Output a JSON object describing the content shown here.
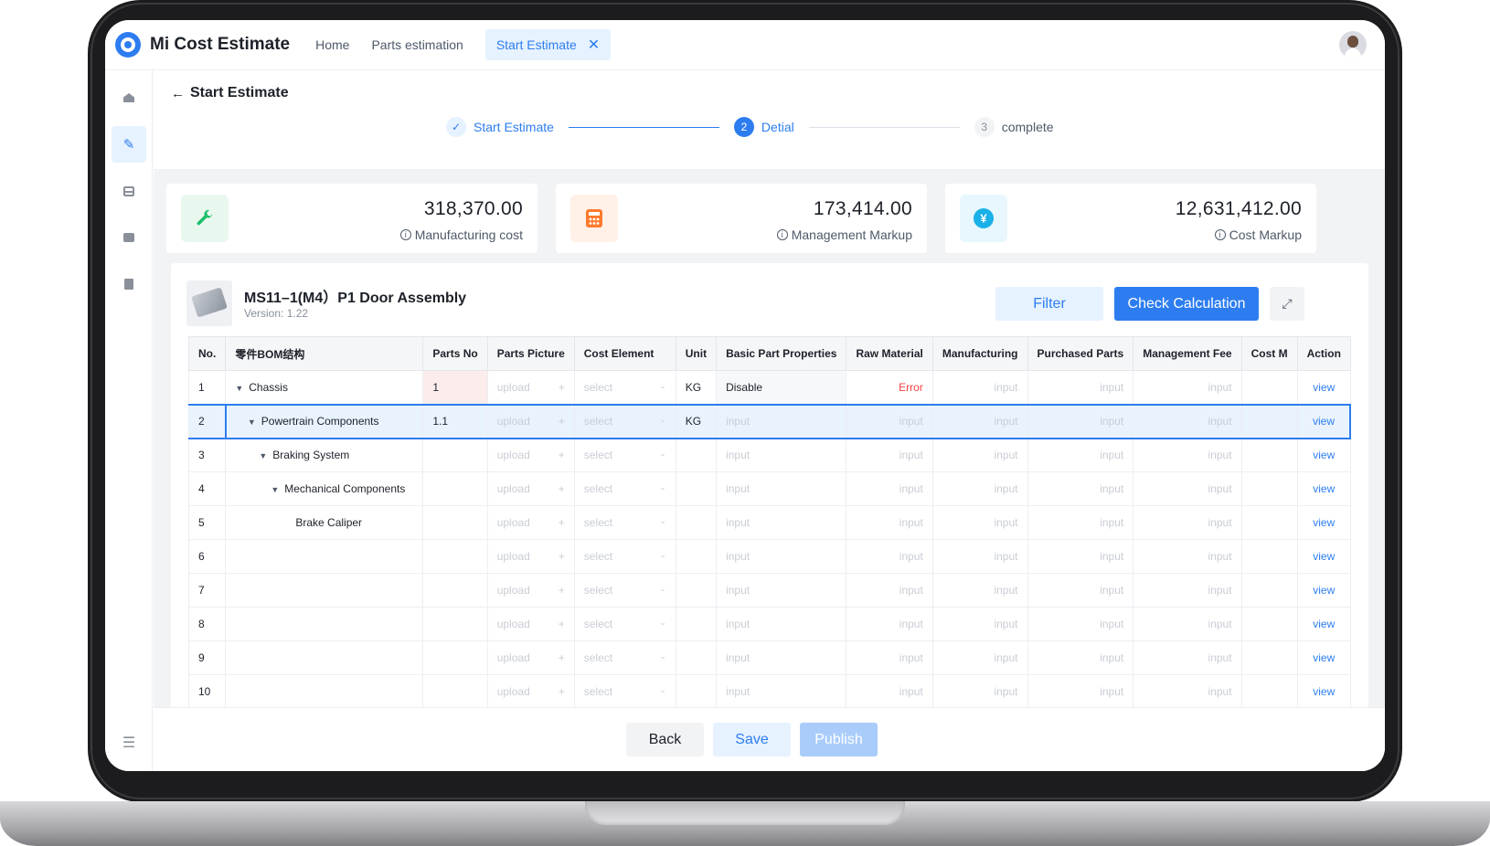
{
  "app": {
    "title": "Mi Cost Estimate"
  },
  "nav": {
    "home": "Home",
    "parts_estimation": "Parts estimation",
    "active_tab": "Start Estimate"
  },
  "page": {
    "title": "Start Estimate"
  },
  "steps": [
    {
      "num": "✓",
      "label": "Start Estimate",
      "state": "done"
    },
    {
      "num": "2",
      "label": "Detial",
      "state": "current"
    },
    {
      "num": "3",
      "label": "complete",
      "state": "todo"
    }
  ],
  "stats": [
    {
      "value": "318,370.00",
      "label": "Manufacturing cost",
      "icon": "wrench-icon",
      "color": "#1fbf6b"
    },
    {
      "value": "173,414.00",
      "label": "Management Markup",
      "icon": "calculator-icon",
      "color": "#ff7a2e"
    },
    {
      "value": "12,631,412.00",
      "label": "Cost Markup",
      "icon": "yen-icon",
      "color": "#1ab0e8"
    }
  ],
  "product": {
    "title": "MS11–1(M4）P1 Door Assembly",
    "version": "Version: 1.22"
  },
  "toolbar": {
    "filter": "Filter",
    "check": "Check Calculation"
  },
  "table": {
    "headers": [
      "No.",
      "零件BOM结构",
      "Parts No",
      "Parts Picture",
      "Cost Element",
      "Unit",
      "Basic Part Properties",
      "Raw Material",
      "Manufacturing",
      "Purchased Parts",
      "Management Fee",
      "Cost M",
      "Action"
    ],
    "placeholders": {
      "upload": "upload",
      "select": "select",
      "input": "input"
    },
    "action_label": "view",
    "rows": [
      {
        "no": "1",
        "name": "Chassis",
        "parts_no": "1",
        "unit": "KG",
        "basic": "Disable",
        "raw": "Error"
      },
      {
        "no": "2",
        "name": "Powertrain Components",
        "parts_no": "1.1",
        "unit": "KG",
        "basic": "",
        "raw": ""
      },
      {
        "no": "3",
        "name": "Braking System",
        "parts_no": "",
        "unit": "",
        "basic": "",
        "raw": ""
      },
      {
        "no": "4",
        "name": "Mechanical Components",
        "parts_no": "",
        "unit": "",
        "basic": "",
        "raw": ""
      },
      {
        "no": "5",
        "name": "Brake Caliper",
        "parts_no": "",
        "unit": "",
        "basic": "",
        "raw": ""
      },
      {
        "no": "6",
        "name": "",
        "parts_no": "",
        "unit": "",
        "basic": "",
        "raw": ""
      },
      {
        "no": "7",
        "name": "",
        "parts_no": "",
        "unit": "",
        "basic": "",
        "raw": ""
      },
      {
        "no": "8",
        "name": "",
        "parts_no": "",
        "unit": "",
        "basic": "",
        "raw": ""
      },
      {
        "no": "9",
        "name": "",
        "parts_no": "",
        "unit": "",
        "basic": "",
        "raw": ""
      },
      {
        "no": "10",
        "name": "",
        "parts_no": "",
        "unit": "",
        "basic": "",
        "raw": ""
      }
    ]
  },
  "footer": {
    "back": "Back",
    "save": "Save",
    "publish": "Publish"
  },
  "colors": {
    "primary": "#2d7df0",
    "error": "#f53f3f"
  }
}
